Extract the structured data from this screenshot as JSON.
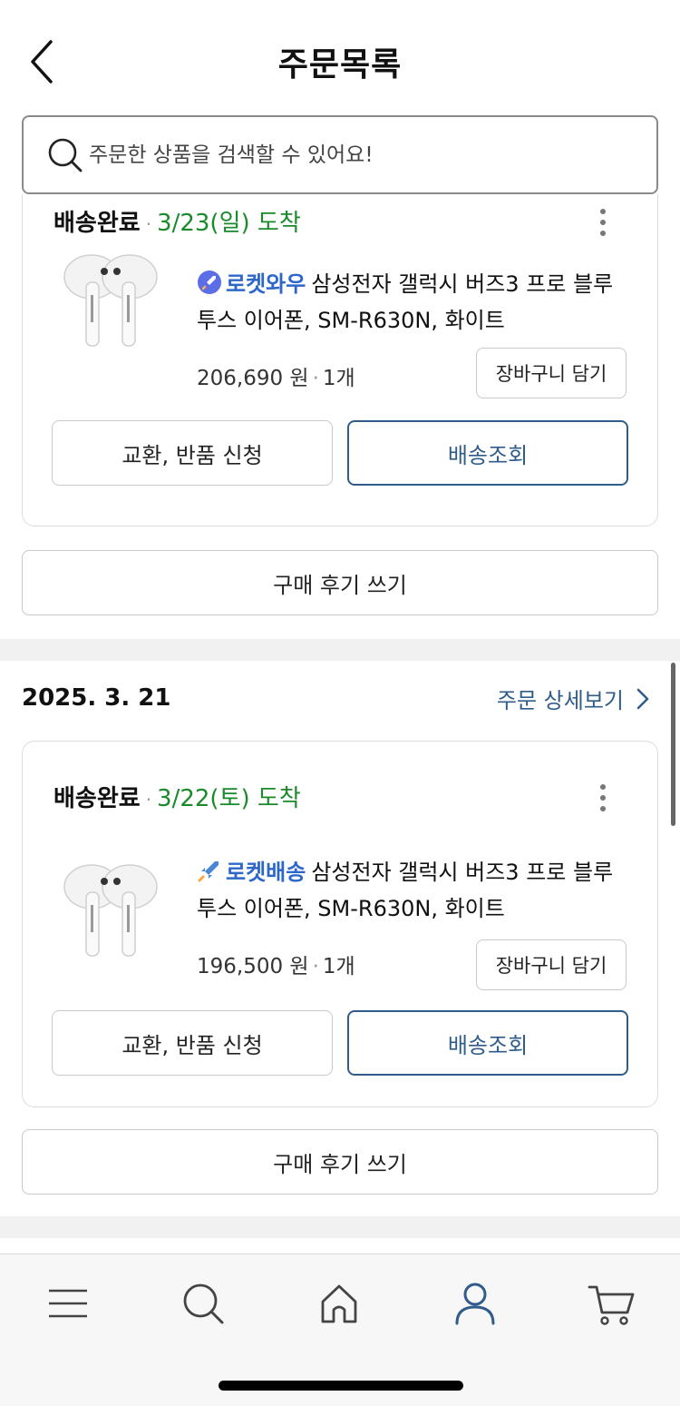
{
  "header": {
    "title": "주문목록"
  },
  "search": {
    "placeholder": "주문한 상품을 검색할 수 있어요!"
  },
  "orders": [
    {
      "status": "배송완료",
      "arrival": "3/23(일) 도착",
      "badge": "로켓와우",
      "product_name": "삼성전자 갤럭시 버즈3 프로 블루투스 이어폰, SM-R630N, 화이트",
      "price": "206,690 원",
      "quantity": "1개",
      "cart_label": "장바구니 담기",
      "exchange_label": "교환, 반품 신청",
      "track_label": "배송조회",
      "review_label": "구매 후기 쓰기"
    },
    {
      "date": "2025. 3. 21",
      "detail_label": "주문 상세보기",
      "status": "배송완료",
      "arrival": "3/22(토) 도착",
      "badge": "로켓배송",
      "product_name": "삼성전자 갤럭시 버즈3 프로 블루투스 이어폰, SM-R630N, 화이트",
      "price": "196,500 원",
      "quantity": "1개",
      "cart_label": "장바구니 담기",
      "exchange_label": "교환, 반품 신청",
      "track_label": "배송조회",
      "review_label": "구매 후기 쓰기"
    }
  ],
  "tabbar": {
    "items": [
      {
        "icon": "menu-icon"
      },
      {
        "icon": "search-icon"
      },
      {
        "icon": "home-icon"
      },
      {
        "icon": "my-page-icon",
        "active": true
      },
      {
        "icon": "cart-icon"
      }
    ]
  },
  "colors": {
    "accent": "#2f5c8a",
    "arrival_green": "#1a8a2a",
    "rocket_blue": "#2d67c9"
  }
}
